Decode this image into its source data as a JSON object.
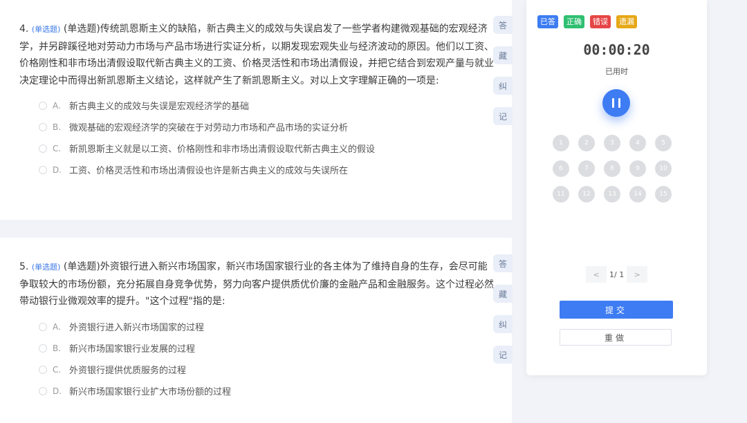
{
  "questions": [
    {
      "number": "4.",
      "type": "(单选题)",
      "text": "(单选题)传统凯恩斯主义的缺陷，新古典主义的成效与失误启发了一些学者构建微观基础的宏观经济学，并另辟蹊径地对劳动力市场与产品市场进行实证分析，以期发现宏观失业与经济波动的原因。他们以工资、价格刚性和非市场出清假设取代新古典主义的工资、价格灵活性和市场出清假设，并把它结合到宏观产量与就业决定理论中而得出新凯恩斯主义结论，这样就产生了新凯恩斯主义。对以上文字理解正确的一项是:",
      "options": [
        {
          "letter": "A.",
          "text": "新古典主义的成效与失误是宏观经济学的基础"
        },
        {
          "letter": "B.",
          "text": "微观基础的宏观经济学的突破在于对劳动力市场和产品市场的实证分析"
        },
        {
          "letter": "C.",
          "text": "新凯恩斯主义就是以工资、价格刚性和非市场出清假设取代新古典主义的假设"
        },
        {
          "letter": "D.",
          "text": "工资、价格灵活性和市场出清假设也许是新古典主义的成效与失误所在"
        }
      ]
    },
    {
      "number": "5.",
      "type": "(单选题)",
      "text": "(单选题)外资银行进入新兴市场国家，新兴市场国家银行业的各主体为了维持自身的生存，会尽可能争取较大的市场份额，充分拓展自身竞争优势，努力向客户提供质优价廉的金融产品和金融服务。这个过程必然带动银行业微观效率的提升。\"这个过程\"指的是:",
      "options": [
        {
          "letter": "A.",
          "text": "外资银行进入新兴市场国家的过程"
        },
        {
          "letter": "B.",
          "text": "新兴市场国家银行业发展的过程"
        },
        {
          "letter": "C.",
          "text": "外资银行提供优质服务的过程"
        },
        {
          "letter": "D.",
          "text": "新兴市场国家银行业扩大市场份额的过程"
        }
      ]
    }
  ],
  "side_tools": [
    "答",
    "藏",
    "纠",
    "记"
  ],
  "legend": [
    {
      "label": "已答",
      "color": "#3d7cf2"
    },
    {
      "label": "正确",
      "color": "#2fbf71"
    },
    {
      "label": "错误",
      "color": "#e64545"
    },
    {
      "label": "遗漏",
      "color": "#e6a817"
    }
  ],
  "timer": {
    "value": "00:00:20",
    "label": "已用时"
  },
  "pause_icon": "pause-icon",
  "answer_card": [
    "1",
    "2",
    "3",
    "4",
    "5",
    "6",
    "7",
    "8",
    "9",
    "10",
    "11",
    "12",
    "13",
    "14",
    "15"
  ],
  "pager": {
    "prev": "<",
    "text": "1/ 1",
    "next": ">"
  },
  "submit_label": "提交",
  "redo_label": "重做"
}
